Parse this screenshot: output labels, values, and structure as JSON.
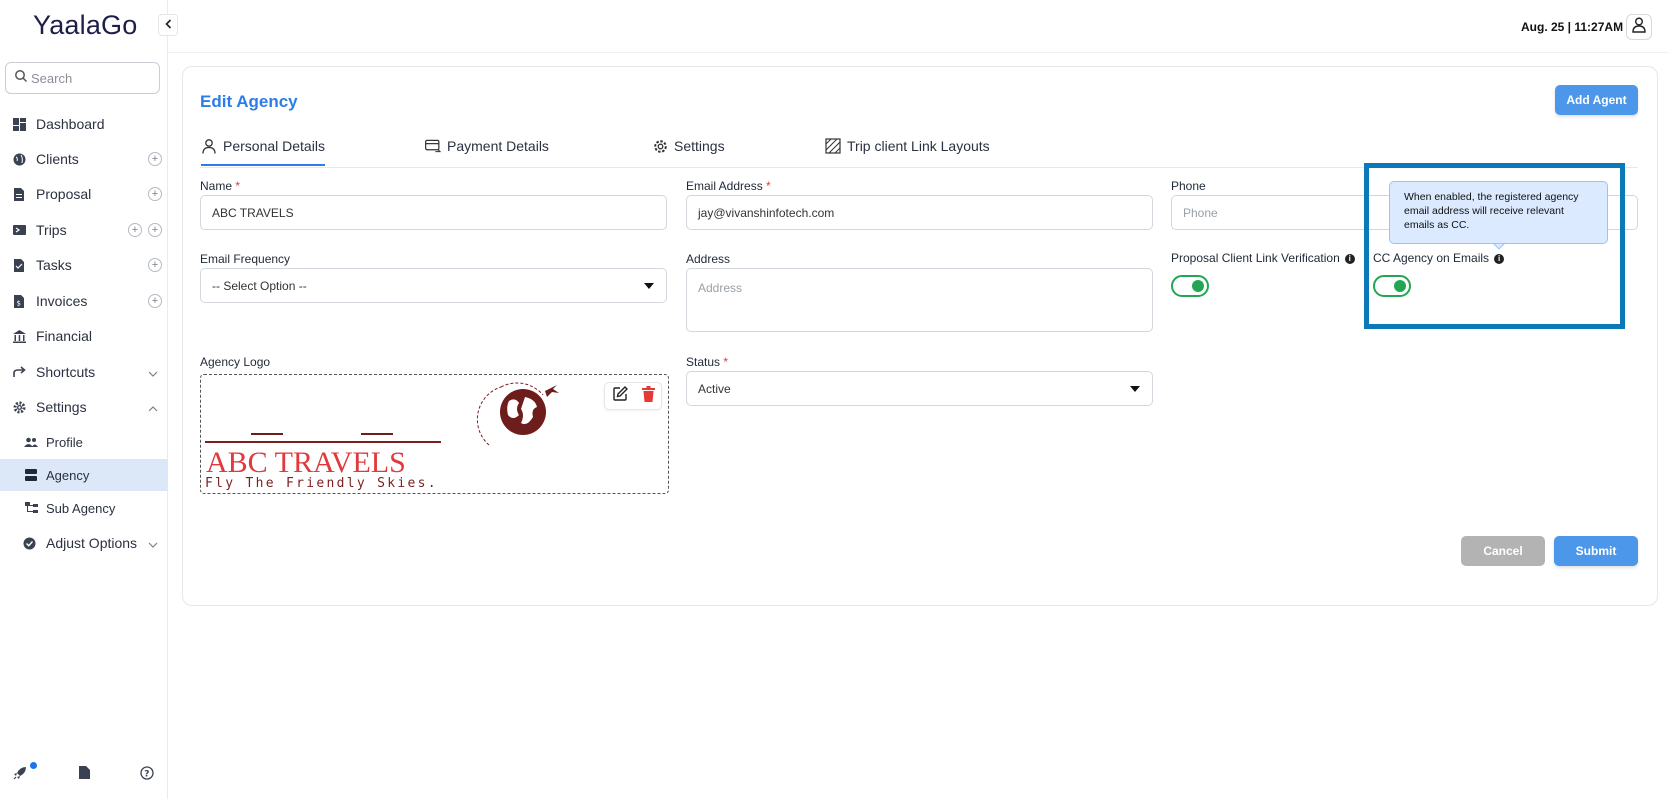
{
  "brand": "YaalaGo",
  "search": {
    "placeholder": "Search"
  },
  "sidebar": {
    "items": [
      {
        "label": "Dashboard"
      },
      {
        "label": "Clients"
      },
      {
        "label": "Proposal"
      },
      {
        "label": "Trips"
      },
      {
        "label": "Tasks"
      },
      {
        "label": "Invoices"
      },
      {
        "label": "Financial"
      },
      {
        "label": "Shortcuts"
      },
      {
        "label": "Settings"
      }
    ],
    "settings_sub": [
      {
        "label": "Profile"
      },
      {
        "label": "Agency"
      },
      {
        "label": "Sub Agency"
      }
    ],
    "adjust_options": "Adjust Options"
  },
  "header": {
    "date": "Aug. 25 | 11:27AM"
  },
  "page": {
    "title": "Edit Agency",
    "add_agent": "Add Agent",
    "cancel": "Cancel",
    "submit": "Submit"
  },
  "tabs": [
    {
      "label": "Personal Details"
    },
    {
      "label": "Payment Details"
    },
    {
      "label": "Settings"
    },
    {
      "label": "Trip client Link Layouts"
    }
  ],
  "form": {
    "name": {
      "label": "Name",
      "required": "*",
      "value": "ABC TRAVELS"
    },
    "email": {
      "label": "Email Address",
      "required": "*",
      "value": "jay@vivanshinfotech.com"
    },
    "phone": {
      "label": "Phone",
      "placeholder": "Phone"
    },
    "email_frequency": {
      "label": "Email Frequency",
      "value": "-- Select Option --"
    },
    "address": {
      "label": "Address",
      "placeholder": "Address"
    },
    "proposal_verification": {
      "label": "Proposal Client Link Verification",
      "enabled": true
    },
    "cc_agency": {
      "label": "CC Agency on Emails",
      "enabled": true
    },
    "agency_logo": {
      "label": "Agency Logo"
    },
    "status": {
      "label": "Status",
      "required": "*",
      "value": "Active"
    }
  },
  "logo": {
    "name": "ABC TRAVELS",
    "tagline": "Fly The Friendly Skies."
  },
  "tooltip": {
    "text": "When enabled, the registered agency email address will receive relevant emails as CC."
  },
  "colors": {
    "accent": "#2b7de9",
    "toggle": "#22a652",
    "highlight": "#0b78b8",
    "danger": "#e53935",
    "logo_red": "#e0393e",
    "logo_maroon": "#7a1f1f"
  }
}
